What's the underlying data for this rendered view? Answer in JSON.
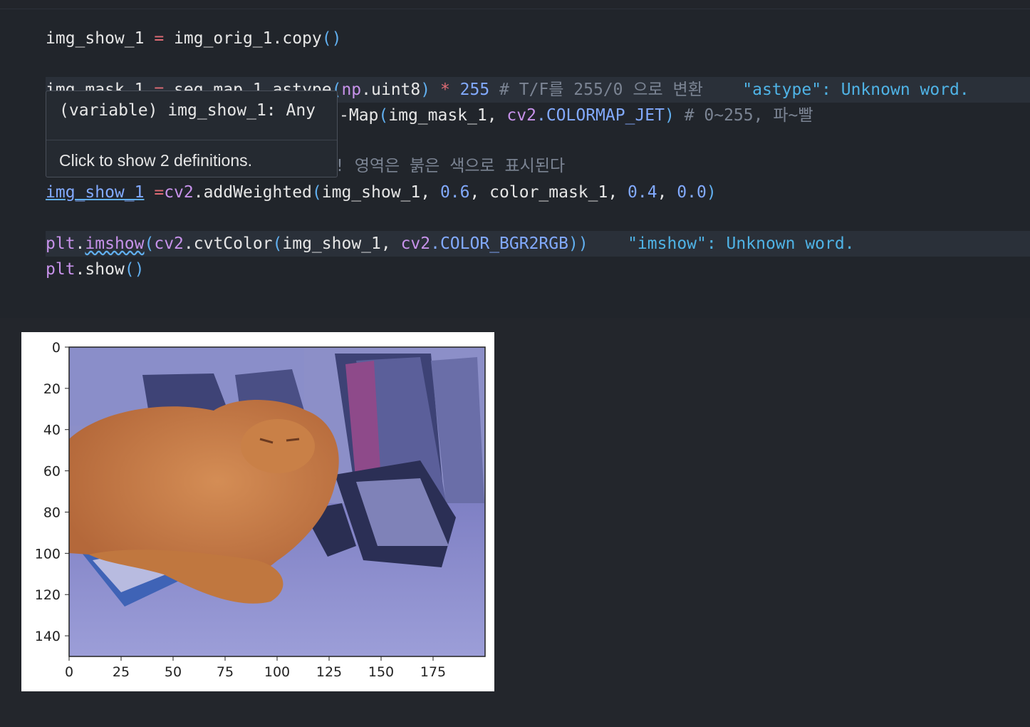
{
  "code": {
    "l1": {
      "a": "img_show_1 ",
      "eq": "=",
      "b": " img_orig_1.copy",
      "p": "()"
    },
    "l2": {
      "a": "img_mask_1 ",
      "eq": "=",
      "b": " seg_map_1.astype",
      "p1": "(",
      "np": "np",
      "c": ".uint8",
      "p2": ")",
      "star": " *",
      "num": " 255",
      "comment": " # T/F를 255/0 으로 변환",
      "warn": "\"astype\": Unknown word."
    },
    "l3": {
      "a": "-Map",
      "p1": "(",
      "b": "img_mask_1, ",
      "cv": "cv2",
      "const": ".COLORMAP_JET",
      "p2": ")",
      "comment": " # 0~255, 파~빨"
    },
    "l4": {
      "comment": "! 영역은 붉은 색으로 표시된다"
    },
    "l5": {
      "var": "img_show_1",
      "eq": " =",
      "cv": "cv2",
      "fn": ".addWeighted",
      "p1": "(",
      "b": "img_show_1, ",
      "n1": "0.6",
      "c": ", color_mask_1, ",
      "n2": "0.4",
      "d": ", ",
      "n3": "0.0",
      "p2": ")"
    },
    "l6": {
      "plt": "plt",
      "dot": ".",
      "fn": "imshow",
      "p1": "(",
      "cv": "cv2",
      "b": ".cvtColor",
      "p2": "(",
      "c": "img_show_1, ",
      "cv2": "cv2",
      "const": ".COLOR_BGR2RGB",
      "p3": "))",
      "warn": "\"imshow\": Unknown word."
    },
    "l7": {
      "plt": "plt",
      "fn": ".show",
      "p": "()"
    }
  },
  "tooltip": {
    "signature": "(variable) img_show_1: Any",
    "link": "Click to show 2 definitions."
  },
  "chart_data": {
    "type": "image",
    "xticks": [
      "0",
      "25",
      "50",
      "75",
      "100",
      "125",
      "150",
      "175"
    ],
    "yticks": [
      "0",
      "20",
      "40",
      "60",
      "80",
      "100",
      "120",
      "140"
    ],
    "xlim": [
      0,
      200
    ],
    "ylim": [
      150,
      0
    ]
  }
}
